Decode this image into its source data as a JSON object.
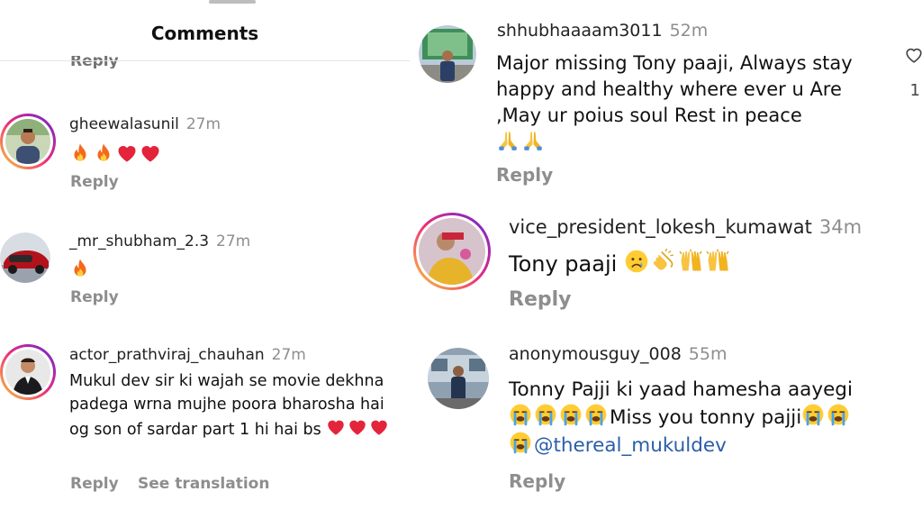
{
  "left_panel": {
    "title": "Comments",
    "previous_reply": "Reply",
    "comments": [
      {
        "username": "gheewalasunil",
        "time": "27m",
        "text": "",
        "emojis": [
          "fire",
          "fire",
          "heart",
          "heart"
        ],
        "reply": "Reply"
      },
      {
        "username": "_mr_shubham_2.3",
        "time": "27m",
        "text": "",
        "emojis": [
          "fire"
        ],
        "reply": "Reply"
      },
      {
        "username": "actor_prathviraj_chauhan",
        "time": "27m",
        "text": "Mukul dev sir ki wajah se movie dekhna padega wrna mujhe poora bharosha hai og son of sardar part 1 hi hai bs",
        "emojis": [
          "heart",
          "heart",
          "heart"
        ],
        "reply": "Reply",
        "see_translation": "See translation"
      }
    ]
  },
  "right_panel": {
    "like_count": "1",
    "comments": [
      {
        "username": "shhubhaaaam3011",
        "time": "52m",
        "text": "Major missing Tony paaji,  Always stay happy and healthy where ever u Are ,May ur poius soul Rest in peace",
        "emojis": [
          "pray",
          "pray"
        ],
        "reply": "Reply"
      },
      {
        "username": "vice_president_lokesh_kumawat",
        "time": "34m",
        "text": "Tony paaji",
        "emojis": [
          "sad",
          "clap",
          "raised-hands",
          "raised-hands"
        ],
        "reply": "Reply"
      },
      {
        "username": "anonymousguy_008",
        "time": "55m",
        "text_line1": "Tonny Pajji ki yaad hamesha aayegi",
        "text_line2": "Miss you tonny pajji",
        "mention": "@thereal_mukuldev",
        "reply": "Reply"
      }
    ]
  },
  "icons": [
    "heart-outline-icon",
    "fire-emoji",
    "heart-emoji",
    "pray-emoji",
    "sad-emoji",
    "clap-emoji",
    "raised-hands-emoji",
    "crying-emoji"
  ],
  "colors": {
    "mention": "#2a5ea8",
    "secondary_text": "#8e8e8e",
    "story_ring_start": "#f9ce34",
    "story_ring_end": "#6228d7"
  }
}
